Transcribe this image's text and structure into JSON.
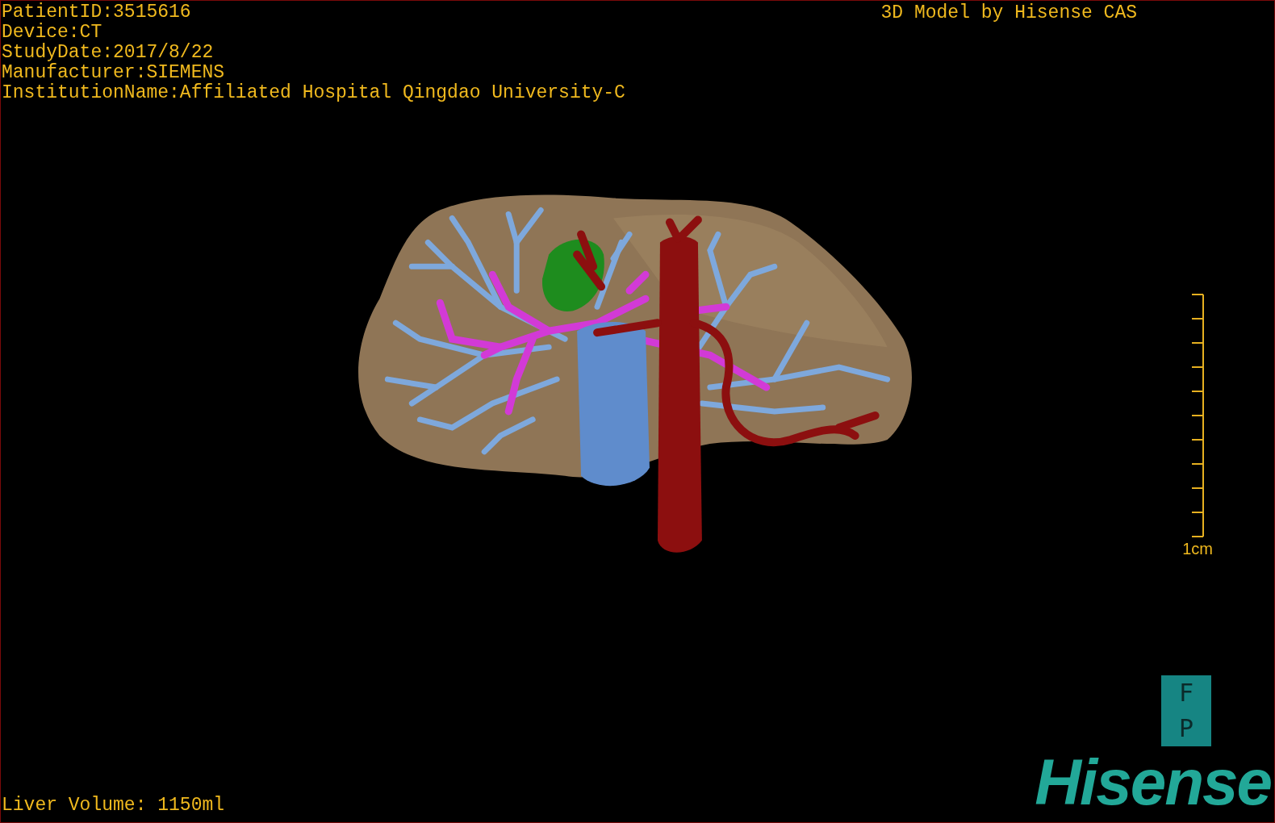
{
  "info_lines": [
    "PatientID:3515616",
    "Device:CT",
    "StudyDate:2017/8/22",
    "Manufacturer:SIEMENS",
    "InstitutionName:Affiliated Hospital Qingdao University-C"
  ],
  "header": "3D Model by Hisense CAS",
  "scale_bar": {
    "label": "1cm"
  },
  "orientation_marker": [
    "F",
    "P"
  ],
  "liver_volume": "Liver Volume: 1150ml",
  "logo": "Hisense"
}
